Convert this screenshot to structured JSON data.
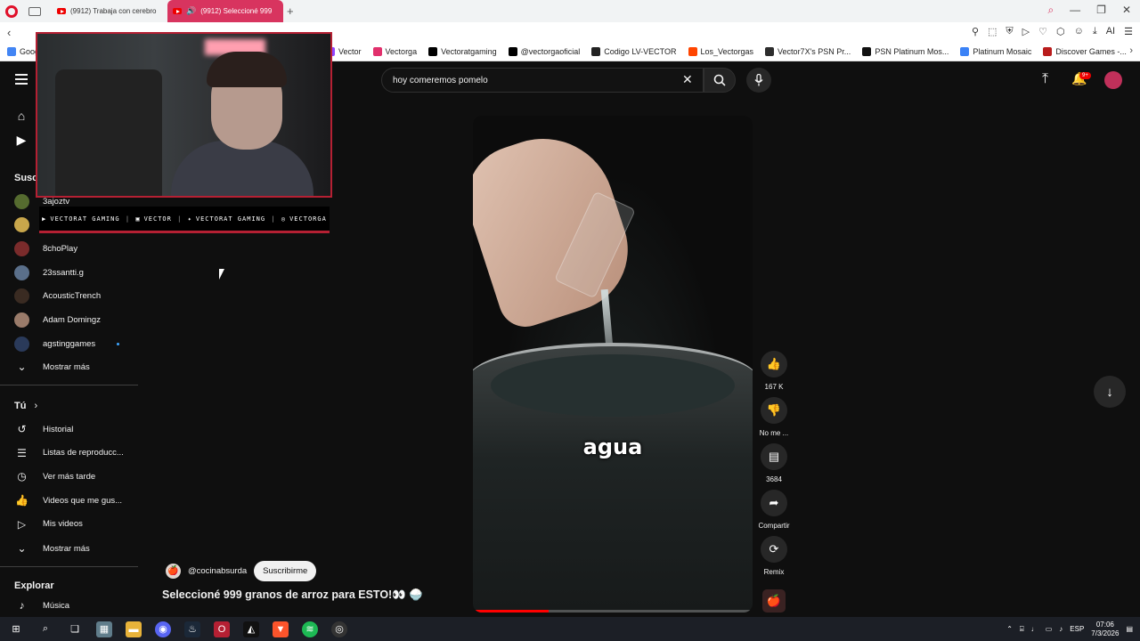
{
  "browser": {
    "tabs": [
      {
        "title": "(9912) Trabaja con cerebro",
        "active": false
      },
      {
        "title": "(9912) Seleccioné 999",
        "active": true
      }
    ],
    "bookmarks": [
      {
        "label": "Goog",
        "color": "#4285f4"
      },
      {
        "label": "Vector",
        "color": "#9146ff"
      },
      {
        "label": "Vectorga",
        "color": "#e1306c"
      },
      {
        "label": "Vectoratgaming",
        "color": "#000000"
      },
      {
        "label": "@vectorgaoficial",
        "color": "#000000"
      },
      {
        "label": "Codigo LV-VECTOR",
        "color": "#222222"
      },
      {
        "label": "Los_Vectorgas",
        "color": "#ff4500"
      },
      {
        "label": "Vector7X's PSN Pr...",
        "color": "#2d2d2d"
      },
      {
        "label": "PSN Platinum Mos...",
        "color": "#111111"
      },
      {
        "label": "Platinum Mosaic",
        "color": "#3b82f6"
      },
      {
        "label": "Discover Games -...",
        "color": "#b91c1c"
      }
    ]
  },
  "youtube": {
    "search": {
      "value": "hoy comeremos pomelo"
    },
    "notifications_badge": "9+",
    "sidebar": {
      "subscriptions_heading": "Susc",
      "subscriptions": [
        {
          "label": "3ajoztv",
          "color": "#556b2f"
        },
        {
          "label": "",
          "color": "#c8a64b"
        },
        {
          "label": "8choPlay",
          "color": "#7a2b2b"
        },
        {
          "label": "23ssantti.g",
          "color": "#5a6f8a"
        },
        {
          "label": "AcousticTrench",
          "color": "#3a2b22"
        },
        {
          "label": "Adam Domingz",
          "color": "#9a7b6a"
        },
        {
          "label": "agstinggames",
          "color": "#2a3a5a"
        }
      ],
      "show_more_1": "Mostrar más",
      "you_heading": "Tú",
      "you_items": [
        {
          "label": "Historial",
          "icon": "history-icon",
          "glyph": "↺"
        },
        {
          "label": "Listas de reproducc...",
          "icon": "playlist-icon",
          "glyph": "☰"
        },
        {
          "label": "Ver más tarde",
          "icon": "clock-icon",
          "glyph": "◷"
        },
        {
          "label": "Videos que me gus...",
          "icon": "thumb-up-icon",
          "glyph": "👍"
        },
        {
          "label": "Mis videos",
          "icon": "my-videos-icon",
          "glyph": "▷"
        }
      ],
      "show_more_2": "Mostrar más",
      "explore_heading": "Explorar",
      "explore_items": [
        {
          "label": "Música",
          "icon": "music-icon",
          "glyph": "♪"
        }
      ]
    },
    "webcam_social": [
      {
        "label": "VECTORAT GAMING",
        "icon": "youtube-icon"
      },
      {
        "label": "VECTOR",
        "icon": "twitch-icon"
      },
      {
        "label": "VECTORAT GAMING",
        "icon": "twitter-icon"
      },
      {
        "label": "VECTORGA",
        "icon": "instagram-icon"
      }
    ],
    "short": {
      "caption": "agua",
      "progress": 0.27,
      "channel": "@cocinabsurda",
      "subscribe_label": "Suscribirme",
      "title": "Seleccioné 999 granos de arroz para ESTO!👀 🍚"
    },
    "actions": {
      "like_count": "167 K",
      "dislike_label": "No me ...",
      "comments_count": "3684",
      "share_label": "Compartir",
      "remix_label": "Remix"
    }
  },
  "taskbar": {
    "language": "ESP",
    "time": "07:06",
    "date": "7/3/2026"
  }
}
